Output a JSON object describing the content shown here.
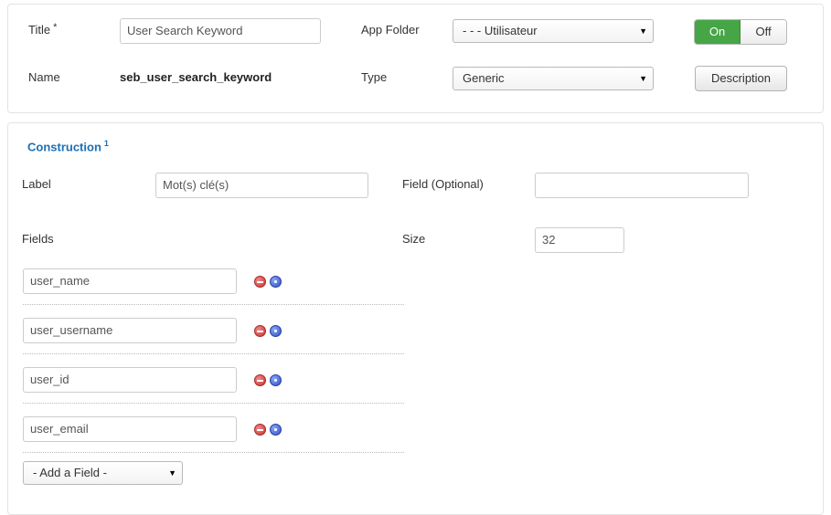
{
  "general": {
    "title_label": "Title",
    "required_mark": "*",
    "title_value": "User Search Keyword",
    "app_folder_label": "App Folder",
    "app_folder_value": "- - - Utilisateur",
    "toggle_on": "On",
    "toggle_off": "Off",
    "name_label": "Name",
    "name_value": "seb_user_search_keyword",
    "type_label": "Type",
    "type_value": "Generic",
    "description_button": "Description"
  },
  "construction": {
    "title": "Construction",
    "title_note": "1",
    "label_label": "Label",
    "label_value": "Mot(s) clé(s)",
    "field_optional_label": "Field (Optional)",
    "field_optional_value": "",
    "fields_label": "Fields",
    "size_label": "Size",
    "size_value": "32",
    "fields": [
      "user_name",
      "user_username",
      "user_id",
      "user_email"
    ],
    "add_field_placeholder": "- Add a Field -"
  },
  "icons": {
    "remove": "remove-circle-icon",
    "add": "add-circle-icon",
    "dropdown": "caret-down-icon"
  },
  "colors": {
    "toggle_on": "#46a546",
    "section_title": "#1a6fb5"
  }
}
